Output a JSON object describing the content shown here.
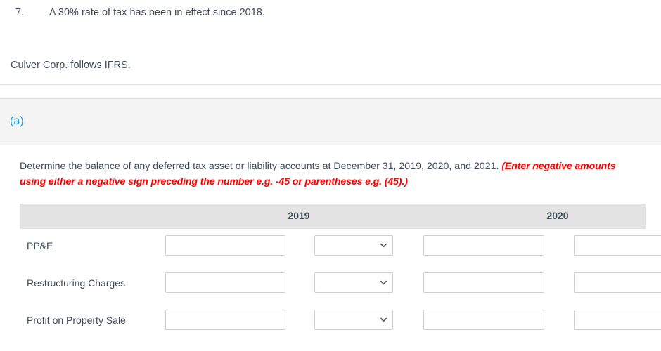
{
  "question": {
    "number": "7.",
    "text": "A 30% rate of tax has been in effect since 2018.",
    "footnote": "Culver Corp. follows IFRS."
  },
  "part": {
    "label": "(a)",
    "accent_color": "#1b9bdd"
  },
  "instructions": {
    "main": "Determine the balance of any deferred tax asset or liability accounts at December 31, 2019, 2020, and 2021. ",
    "hint": "(Enter negative amounts using either a negative sign preceding the number e.g. -45 or parentheses e.g. (45).)",
    "hint_color": "#fe0000"
  },
  "table": {
    "header_background": "#e3e3e3",
    "columns": [
      "",
      "2019",
      "",
      "2020",
      ""
    ],
    "year_headers": [
      "2019",
      "2020"
    ],
    "rows": [
      {
        "label": "PP&E",
        "amount_2019": "",
        "type_2019": "",
        "amount_2020": "",
        "amount_2021": "",
        "placeholder": ""
      },
      {
        "label": "Restructuring Charges",
        "amount_2019": "",
        "type_2019": "",
        "amount_2020": "",
        "amount_2021": "",
        "placeholder": ""
      },
      {
        "label": "Profit on Property Sale",
        "amount_2019": "",
        "type_2019": "",
        "amount_2020": "",
        "amount_2021": "",
        "placeholder": ""
      }
    ],
    "select_icon": "chevron-down-icon"
  }
}
